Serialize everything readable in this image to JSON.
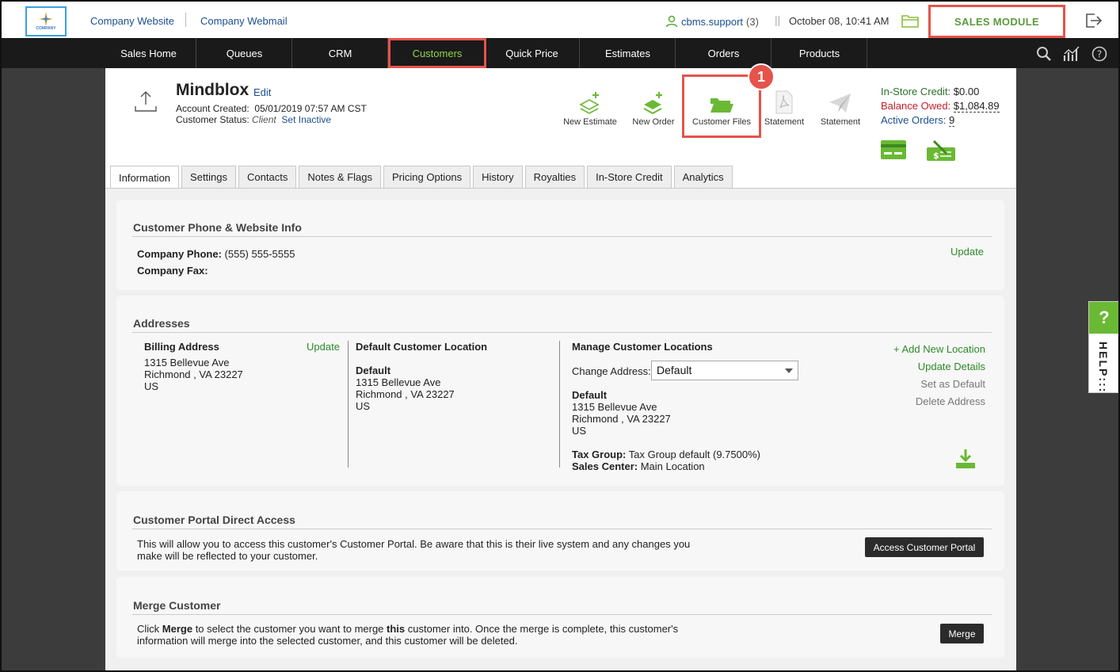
{
  "topbar": {
    "logo_text": "COMPANY",
    "company_website": "Company Website",
    "company_webmail": "Company Webmail",
    "user": "cbms.support",
    "user_count": "(3)",
    "separator": "||",
    "datetime": "October 08, 10:41 AM",
    "module": "SALES MODULE"
  },
  "nav": {
    "items": [
      "Sales Home",
      "Queues",
      "CRM",
      "Customers",
      "Quick Price",
      "Estimates",
      "Orders",
      "Products"
    ],
    "active": "Customers"
  },
  "customer": {
    "name": "Mindblox",
    "edit": "Edit",
    "account_created_label": "Account Created:",
    "account_created_value": "05/01/2019 07:57 AM CST",
    "status_label": "Customer Status:",
    "status_value": "Client",
    "set_inactive": "Set Inactive"
  },
  "actions": {
    "new_estimate": "New Estimate",
    "new_order": "New Order",
    "customer_files": "Customer Files",
    "statement_pdf": "Statement",
    "statement_send": "Statement",
    "badge": "1"
  },
  "credit": {
    "in_store_label": "In-Store Credit:",
    "in_store_value": "$0.00",
    "balance_label": "Balance Owed:",
    "balance_value": "$1,084.89",
    "active_orders_label": "Active Orders:",
    "active_orders_value": "9"
  },
  "tabs": [
    "Information",
    "Settings",
    "Contacts",
    "Notes & Flags",
    "Pricing Options",
    "History",
    "Royalties",
    "In-Store Credit",
    "Analytics"
  ],
  "phone_card": {
    "title": "Customer Phone & Website Info",
    "phone_label": "Company Phone:",
    "phone_value": "(555) 555-5555",
    "fax_label": "Company Fax:",
    "update": "Update"
  },
  "addresses": {
    "title": "Addresses",
    "billing_title": "Billing Address",
    "billing_update": "Update",
    "billing_lines": [
      "1315 Bellevue Ave",
      "Richmond , VA 23227",
      "US"
    ],
    "default_title": "Default Customer Location",
    "default_name": "Default",
    "default_lines": [
      "1315 Bellevue Ave",
      "Richmond , VA 23227",
      "US"
    ],
    "manage_title": "Manage Customer Locations",
    "change_label": "Change Address:",
    "change_value": "Default",
    "manage_name": "Default",
    "manage_lines": [
      "1315 Bellevue Ave",
      "Richmond , VA 23227",
      "US"
    ],
    "tax_label": "Tax Group:",
    "tax_value": "Tax Group default (9.7500%)",
    "sales_label": "Sales Center:",
    "sales_value": "Main Location",
    "add_location": "+ Add New Location",
    "update_details": "Update Details",
    "set_default": "Set as Default",
    "delete_address": "Delete Address"
  },
  "portal": {
    "title": "Customer Portal Direct Access",
    "text_line1": "This will allow you to access this customer's Customer Portal. Be aware that this is their live system and any changes you",
    "text_line2": "make will be reflected to your customer.",
    "button": "Access Customer Portal"
  },
  "merge": {
    "title": "Merge Customer",
    "l1_a": "Click ",
    "l1_b": "Merge",
    "l1_c": " to select the customer you want to merge ",
    "l1_d": "this",
    "l1_e": " customer into. Once the merge is complete, this customer's",
    "line2": "information will merge into the selected customer, and this customer will be deleted.",
    "button": "Merge"
  },
  "help": {
    "q": "?",
    "label": "HELP:::"
  },
  "colors": {
    "accent_green": "#6ab934",
    "highlight_red": "#e5534b",
    "nav_bg": "#1a1a1a"
  }
}
